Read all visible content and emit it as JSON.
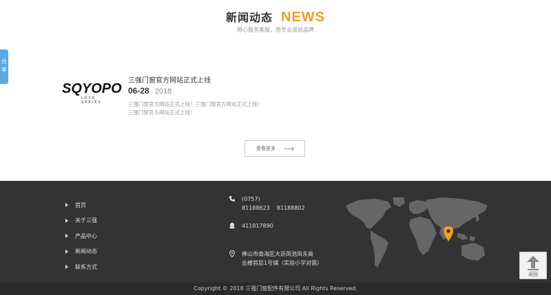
{
  "header": {
    "title_cn": "新闻动态",
    "title_en": "NEWS",
    "subtitle": "用心服务客服，用专业成就品牌",
    "accent": "#f0a020"
  },
  "share": {
    "label_1": "分",
    "label_2": "享"
  },
  "news_item": {
    "logo_text": "SQYOPO",
    "logo_tag": "LOCK SERIES",
    "title": "三强门窗官方网站正式上线",
    "date_md": "06-28",
    "date_year": "2018",
    "description": "三强门窗官方网站正式上线！三强门窗官方网站正式上线！三强门窗官方网站正式上线！"
  },
  "more_button": {
    "label": "查看更多"
  },
  "footer": {
    "nav": [
      "首页",
      "关于三强",
      "产品中心",
      "新闻动态",
      "联系方式"
    ],
    "phone_area": "(0757)",
    "phone_numbers": "81188623    81188802",
    "qq": "411817890",
    "address_line1": "佛山市南海区大沥凤池凤东商",
    "address_line2": "业楼首层1号铺（实验小学对面）",
    "background": "#333333"
  },
  "copyright": "Copyright © 2018 三强门窗配件有限公司 All Rights Reserved.",
  "back_top": {
    "label": "返回"
  }
}
